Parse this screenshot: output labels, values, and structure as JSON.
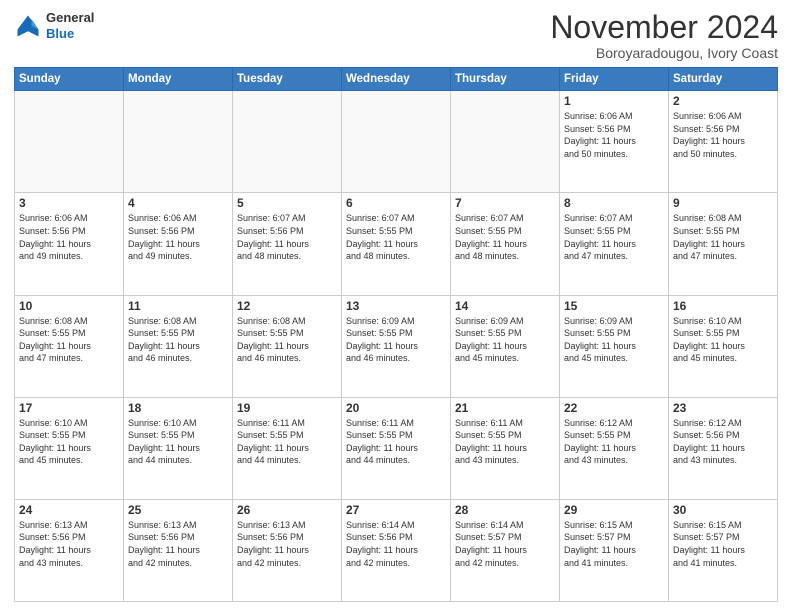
{
  "logo": {
    "general": "General",
    "blue": "Blue"
  },
  "title": "November 2024",
  "location": "Boroyaradougou, Ivory Coast",
  "days_of_week": [
    "Sunday",
    "Monday",
    "Tuesday",
    "Wednesday",
    "Thursday",
    "Friday",
    "Saturday"
  ],
  "weeks": [
    [
      {
        "day": "",
        "info": ""
      },
      {
        "day": "",
        "info": ""
      },
      {
        "day": "",
        "info": ""
      },
      {
        "day": "",
        "info": ""
      },
      {
        "day": "",
        "info": ""
      },
      {
        "day": "1",
        "info": "Sunrise: 6:06 AM\nSunset: 5:56 PM\nDaylight: 11 hours\nand 50 minutes."
      },
      {
        "day": "2",
        "info": "Sunrise: 6:06 AM\nSunset: 5:56 PM\nDaylight: 11 hours\nand 50 minutes."
      }
    ],
    [
      {
        "day": "3",
        "info": "Sunrise: 6:06 AM\nSunset: 5:56 PM\nDaylight: 11 hours\nand 49 minutes."
      },
      {
        "day": "4",
        "info": "Sunrise: 6:06 AM\nSunset: 5:56 PM\nDaylight: 11 hours\nand 49 minutes."
      },
      {
        "day": "5",
        "info": "Sunrise: 6:07 AM\nSunset: 5:56 PM\nDaylight: 11 hours\nand 48 minutes."
      },
      {
        "day": "6",
        "info": "Sunrise: 6:07 AM\nSunset: 5:55 PM\nDaylight: 11 hours\nand 48 minutes."
      },
      {
        "day": "7",
        "info": "Sunrise: 6:07 AM\nSunset: 5:55 PM\nDaylight: 11 hours\nand 48 minutes."
      },
      {
        "day": "8",
        "info": "Sunrise: 6:07 AM\nSunset: 5:55 PM\nDaylight: 11 hours\nand 47 minutes."
      },
      {
        "day": "9",
        "info": "Sunrise: 6:08 AM\nSunset: 5:55 PM\nDaylight: 11 hours\nand 47 minutes."
      }
    ],
    [
      {
        "day": "10",
        "info": "Sunrise: 6:08 AM\nSunset: 5:55 PM\nDaylight: 11 hours\nand 47 minutes."
      },
      {
        "day": "11",
        "info": "Sunrise: 6:08 AM\nSunset: 5:55 PM\nDaylight: 11 hours\nand 46 minutes."
      },
      {
        "day": "12",
        "info": "Sunrise: 6:08 AM\nSunset: 5:55 PM\nDaylight: 11 hours\nand 46 minutes."
      },
      {
        "day": "13",
        "info": "Sunrise: 6:09 AM\nSunset: 5:55 PM\nDaylight: 11 hours\nand 46 minutes."
      },
      {
        "day": "14",
        "info": "Sunrise: 6:09 AM\nSunset: 5:55 PM\nDaylight: 11 hours\nand 45 minutes."
      },
      {
        "day": "15",
        "info": "Sunrise: 6:09 AM\nSunset: 5:55 PM\nDaylight: 11 hours\nand 45 minutes."
      },
      {
        "day": "16",
        "info": "Sunrise: 6:10 AM\nSunset: 5:55 PM\nDaylight: 11 hours\nand 45 minutes."
      }
    ],
    [
      {
        "day": "17",
        "info": "Sunrise: 6:10 AM\nSunset: 5:55 PM\nDaylight: 11 hours\nand 45 minutes."
      },
      {
        "day": "18",
        "info": "Sunrise: 6:10 AM\nSunset: 5:55 PM\nDaylight: 11 hours\nand 44 minutes."
      },
      {
        "day": "19",
        "info": "Sunrise: 6:11 AM\nSunset: 5:55 PM\nDaylight: 11 hours\nand 44 minutes."
      },
      {
        "day": "20",
        "info": "Sunrise: 6:11 AM\nSunset: 5:55 PM\nDaylight: 11 hours\nand 44 minutes."
      },
      {
        "day": "21",
        "info": "Sunrise: 6:11 AM\nSunset: 5:55 PM\nDaylight: 11 hours\nand 43 minutes."
      },
      {
        "day": "22",
        "info": "Sunrise: 6:12 AM\nSunset: 5:55 PM\nDaylight: 11 hours\nand 43 minutes."
      },
      {
        "day": "23",
        "info": "Sunrise: 6:12 AM\nSunset: 5:56 PM\nDaylight: 11 hours\nand 43 minutes."
      }
    ],
    [
      {
        "day": "24",
        "info": "Sunrise: 6:13 AM\nSunset: 5:56 PM\nDaylight: 11 hours\nand 43 minutes."
      },
      {
        "day": "25",
        "info": "Sunrise: 6:13 AM\nSunset: 5:56 PM\nDaylight: 11 hours\nand 42 minutes."
      },
      {
        "day": "26",
        "info": "Sunrise: 6:13 AM\nSunset: 5:56 PM\nDaylight: 11 hours\nand 42 minutes."
      },
      {
        "day": "27",
        "info": "Sunrise: 6:14 AM\nSunset: 5:56 PM\nDaylight: 11 hours\nand 42 minutes."
      },
      {
        "day": "28",
        "info": "Sunrise: 6:14 AM\nSunset: 5:57 PM\nDaylight: 11 hours\nand 42 minutes."
      },
      {
        "day": "29",
        "info": "Sunrise: 6:15 AM\nSunset: 5:57 PM\nDaylight: 11 hours\nand 41 minutes."
      },
      {
        "day": "30",
        "info": "Sunrise: 6:15 AM\nSunset: 5:57 PM\nDaylight: 11 hours\nand 41 minutes."
      }
    ]
  ]
}
